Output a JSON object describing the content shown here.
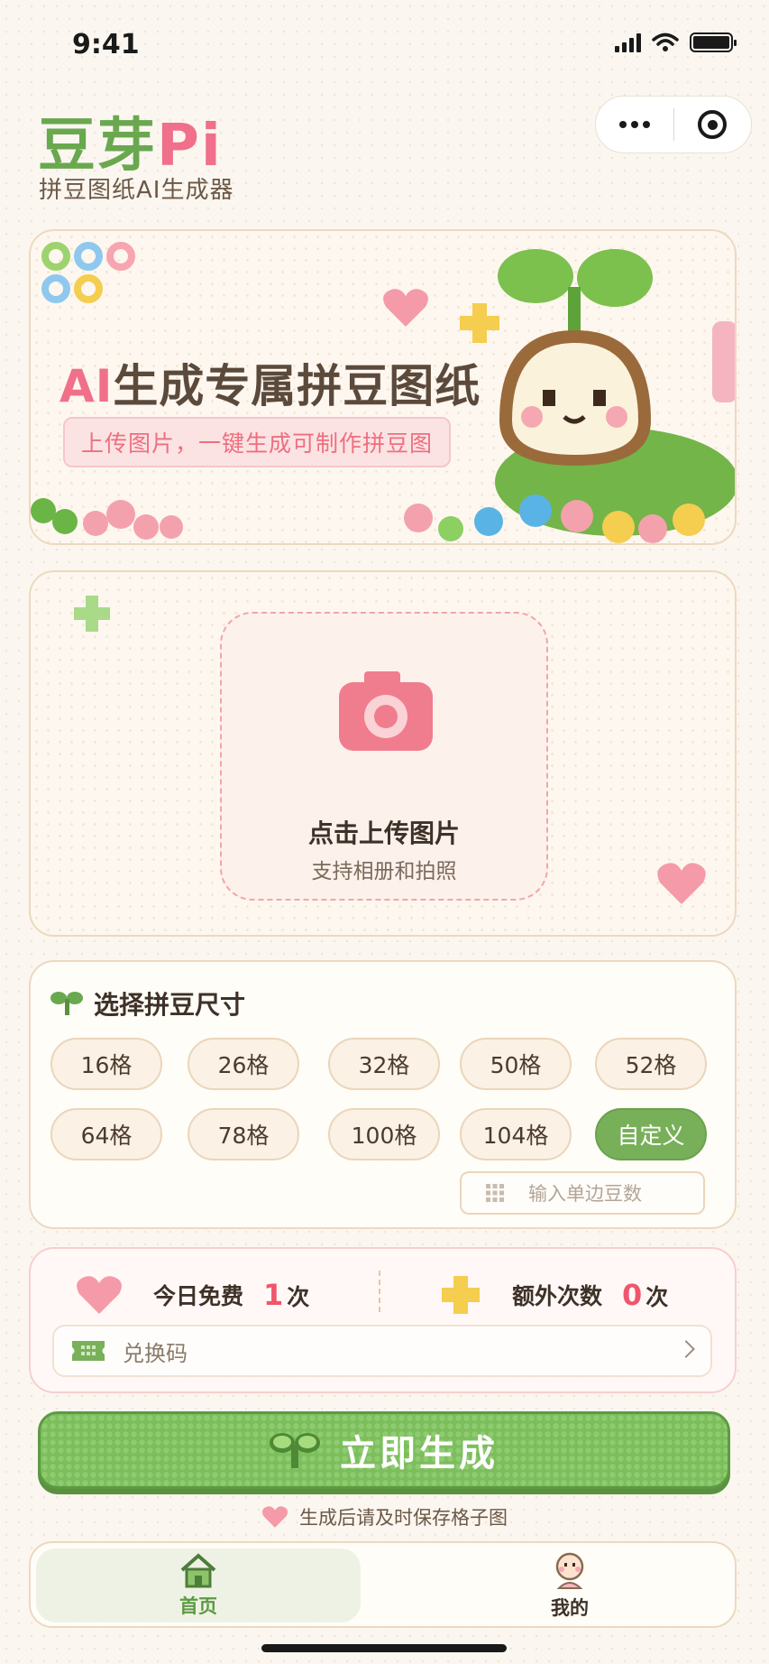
{
  "status_bar": {
    "time": "9:41"
  },
  "header": {
    "logo_part1": "豆芽",
    "logo_part2": "Pi",
    "subtitle": "拼豆图纸AI生成器"
  },
  "banner": {
    "title_ai": "AI",
    "title_rest": "生成专属拼豆图纸",
    "pill": "上传图片，一键生成可制作拼豆图"
  },
  "upload": {
    "title": "点击上传图片",
    "subtitle": "支持相册和拍照"
  },
  "size_selector": {
    "heading": "选择拼豆尺寸",
    "options": [
      "16格",
      "26格",
      "32格",
      "50格",
      "52格",
      "64格",
      "78格",
      "100格",
      "104格",
      "自定义"
    ],
    "selected": "自定义",
    "custom_placeholder": "输入单边豆数"
  },
  "quota": {
    "free_label": "今日免费",
    "free_count": "1",
    "free_unit": "次",
    "extra_label": "额外次数",
    "extra_count": "0",
    "extra_unit": "次",
    "redeem_label": "兑换码"
  },
  "generate_button": {
    "label": "立即生成"
  },
  "tip": "生成后请及时保存格子图",
  "tabbar": {
    "items": [
      {
        "label": "首页",
        "icon": "home-icon",
        "active": true
      },
      {
        "label": "我的",
        "icon": "profile-icon",
        "active": false
      }
    ]
  },
  "colors": {
    "brand_green": "#6aa84f",
    "brand_pink": "#f06f8a",
    "count_red": "#f0566b",
    "background": "#fbf7f0"
  }
}
